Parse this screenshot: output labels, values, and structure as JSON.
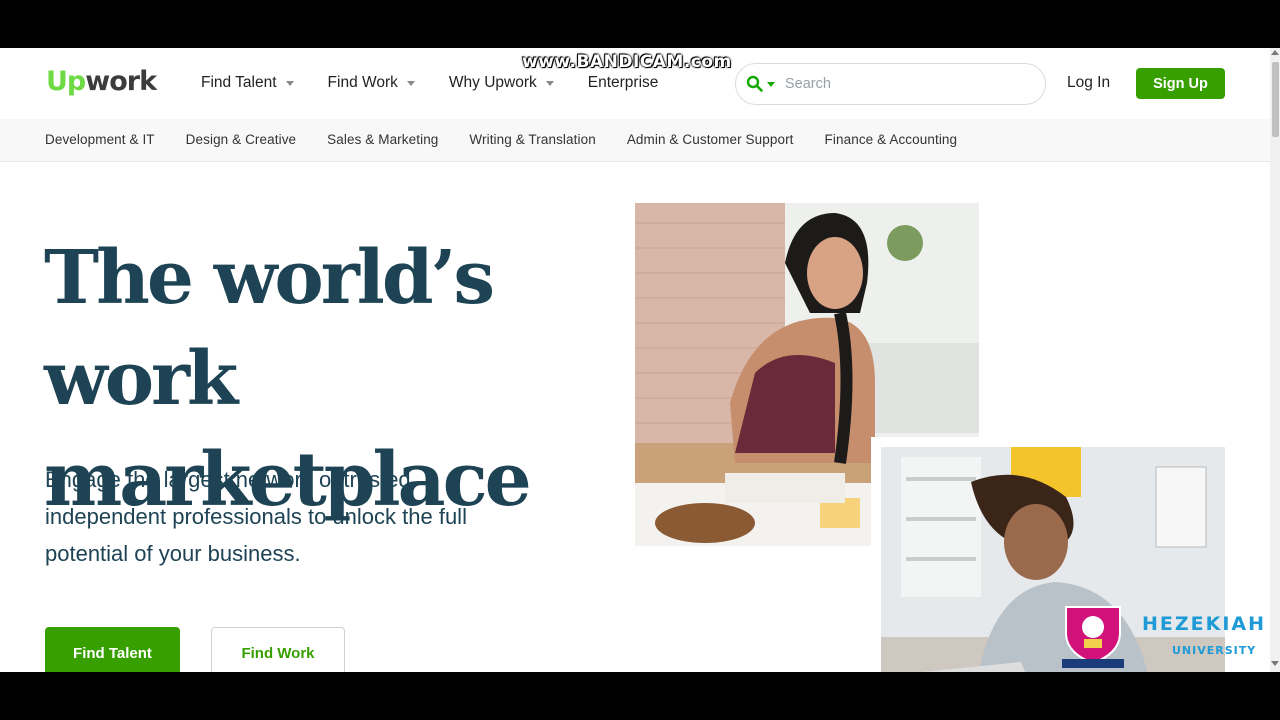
{
  "watermark": "www.BANDICAM.com",
  "header": {
    "logo_up": "Up",
    "logo_work": "work",
    "nav": [
      {
        "label": "Find Talent",
        "has_caret": true
      },
      {
        "label": "Find Work",
        "has_caret": true
      },
      {
        "label": "Why Upwork",
        "has_caret": true
      },
      {
        "label": "Enterprise",
        "has_caret": false
      }
    ],
    "search_placeholder": "Search",
    "login_label": "Log In",
    "signup_label": "Sign Up"
  },
  "categories": [
    "Development & IT",
    "Design & Creative",
    "Sales & Marketing",
    "Writing & Translation",
    "Admin & Customer Support",
    "Finance & Accounting"
  ],
  "hero": {
    "title_line1": "The world’s work",
    "title_line2": "marketplace",
    "subtitle": "Engage the largest network of trusted independent professionals to unlock the full potential of your business.",
    "primary_button": "Find Talent",
    "secondary_button": "Find Work"
  },
  "overlay": {
    "university_name": "HEZEKIAH",
    "university_sub": "UNIVERSITY"
  },
  "colors": {
    "brand_green": "#37a000",
    "logo_green": "#6fda44",
    "heading_navy": "#1d4354"
  }
}
